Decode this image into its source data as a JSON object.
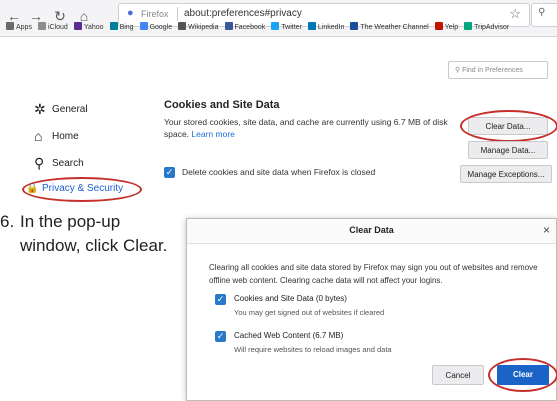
{
  "browser": {
    "url_brand": "Firefox",
    "url": "about:preferences#privacy",
    "bookmarks": [
      {
        "label": "Apps",
        "color": "#6b6b6b"
      },
      {
        "label": "iCloud",
        "color": "#8c8c8c"
      },
      {
        "label": "Yahoo",
        "color": "#5c2d91"
      },
      {
        "label": "Bing",
        "color": "#00809d"
      },
      {
        "label": "Google",
        "color": "#4285f4"
      },
      {
        "label": "Wikipedia",
        "color": "#555555"
      },
      {
        "label": "Facebook",
        "color": "#3b5998"
      },
      {
        "label": "Twitter",
        "color": "#1da1f2"
      },
      {
        "label": "LinkedIn",
        "color": "#0077b5"
      },
      {
        "label": "The Weather Channel",
        "color": "#1b4f9c"
      },
      {
        "label": "Yelp",
        "color": "#c41200"
      },
      {
        "label": "TripAdvisor",
        "color": "#00a680"
      }
    ]
  },
  "prefs": {
    "find_placeholder": "Find in Preferences",
    "sidebar": [
      {
        "label": "General",
        "icon": "gear-icon",
        "glyph": "✲"
      },
      {
        "label": "Home",
        "icon": "home-icon",
        "glyph": "⌂"
      },
      {
        "label": "Search",
        "icon": "search-icon",
        "glyph": "⚲"
      },
      {
        "label": "Privacy & Security",
        "icon": "lock-icon",
        "glyph": "🔒"
      }
    ],
    "cookies_title": "Cookies and Site Data",
    "cookies_desc": "Your stored cookies, site data, and cache are currently using 6.7 MB of disk space.",
    "learn_more": "Learn more",
    "clear_data_btn": "Clear Data...",
    "manage_data_btn": "Manage Data...",
    "manage_exceptions_btn": "Manage Exceptions...",
    "delete_on_close": "Delete cookies and site data when Firefox is closed"
  },
  "instruction": {
    "number": "6.",
    "text": "In the pop-up window, click Clear."
  },
  "dialog": {
    "title": "Clear Data",
    "intro": "Clearing all cookies and site data stored by Firefox may sign you out of websites and remove offline web content. Clearing cache data will not affect your logins.",
    "option1_label": "Cookies and Site Data (0 bytes)",
    "option1_sub": "You may get signed out of websites if cleared",
    "option2_label": "Cached Web Content (6.7 MB)",
    "option2_sub": "Will require websites to reload images and data",
    "cancel": "Cancel",
    "clear": "Clear"
  },
  "colors": {
    "accent": "#1b63c7",
    "highlight_ring": "#c4302b"
  }
}
